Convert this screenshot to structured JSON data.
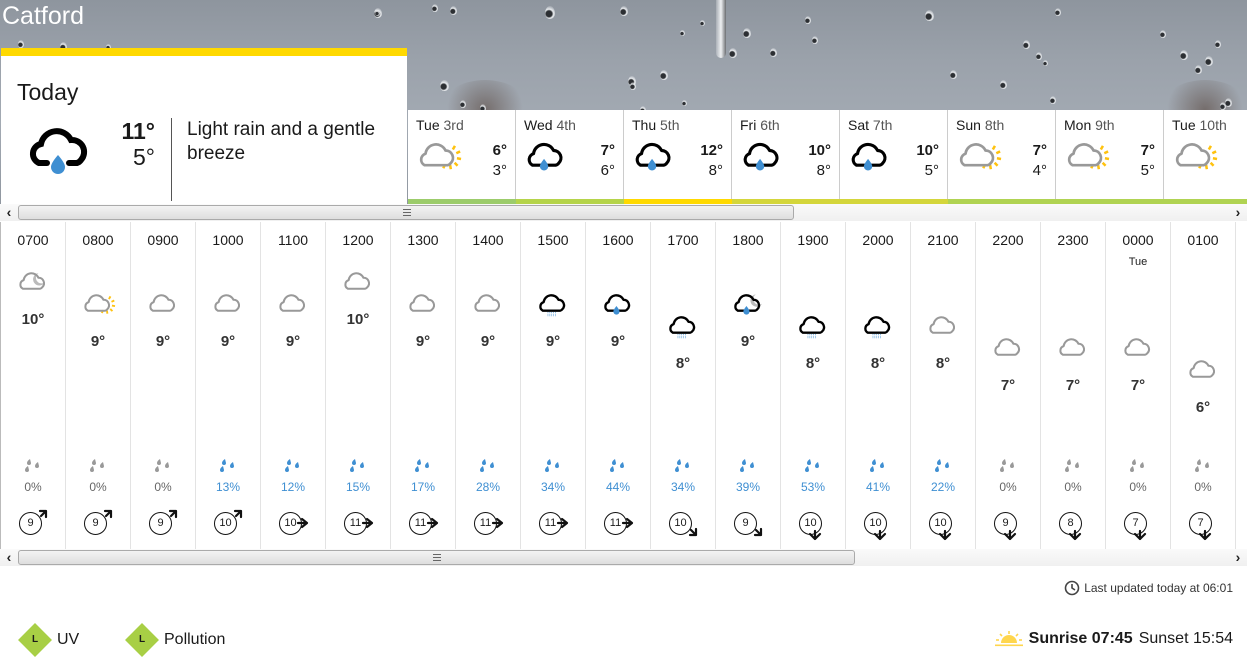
{
  "location": "Catford",
  "today": {
    "title": "Today",
    "icon": "light-rain-icon",
    "max": "11°",
    "min": "5°",
    "description": "Light rain and a gentle breeze",
    "accent_color": "#ffd900"
  },
  "days": [
    {
      "day": "Tue",
      "date": "3rd",
      "icon": "sunny-intervals-icon",
      "max": "6°",
      "min": "3°",
      "bar_color": "#9ccc6b"
    },
    {
      "day": "Wed",
      "date": "4th",
      "icon": "light-rain-icon",
      "max": "7°",
      "min": "6°",
      "bar_color": "#b5d44a"
    },
    {
      "day": "Thu",
      "date": "5th",
      "icon": "light-rain-icon",
      "max": "12°",
      "min": "8°",
      "bar_color": "#ffd900"
    },
    {
      "day": "Fri",
      "date": "6th",
      "icon": "light-rain-icon",
      "max": "10°",
      "min": "8°",
      "bar_color": "#d4d63b"
    },
    {
      "day": "Sat",
      "date": "7th",
      "icon": "light-rain-icon",
      "max": "10°",
      "min": "5°",
      "bar_color": "#d4d63b"
    },
    {
      "day": "Sun",
      "date": "8th",
      "icon": "sunny-intervals-icon",
      "max": "7°",
      "min": "4°",
      "bar_color": "#b0d352"
    },
    {
      "day": "Mon",
      "date": "9th",
      "icon": "sunny-intervals-icon",
      "max": "7°",
      "min": "5°",
      "bar_color": "#b0d352"
    },
    {
      "day": "Tue",
      "date": "10th",
      "icon": "sunny-intervals-icon",
      "max": "",
      "min": "",
      "bar_color": "#b0d352"
    }
  ],
  "hours": [
    {
      "time": "0700",
      "day": "",
      "icon": "partly-cloudy-night-icon",
      "temp": "10°",
      "rain": "0%",
      "wind": "9",
      "wind_dir": "ne"
    },
    {
      "time": "0800",
      "day": "",
      "icon": "sunny-intervals-icon",
      "temp": "9°",
      "rain": "0%",
      "wind": "9",
      "wind_dir": "ne"
    },
    {
      "time": "0900",
      "day": "",
      "icon": "light-cloud-icon",
      "temp": "9°",
      "rain": "0%",
      "wind": "9",
      "wind_dir": "ne"
    },
    {
      "time": "1000",
      "day": "",
      "icon": "light-cloud-icon",
      "temp": "9°",
      "rain": "13%",
      "wind": "10",
      "wind_dir": "ne"
    },
    {
      "time": "1100",
      "day": "",
      "icon": "light-cloud-icon",
      "temp": "9°",
      "rain": "12%",
      "wind": "10",
      "wind_dir": "e"
    },
    {
      "time": "1200",
      "day": "",
      "icon": "light-cloud-icon",
      "temp": "10°",
      "rain": "15%",
      "wind": "11",
      "wind_dir": "e"
    },
    {
      "time": "1300",
      "day": "",
      "icon": "light-cloud-icon",
      "temp": "9°",
      "rain": "17%",
      "wind": "11",
      "wind_dir": "e"
    },
    {
      "time": "1400",
      "day": "",
      "icon": "light-cloud-icon",
      "temp": "9°",
      "rain": "28%",
      "wind": "11",
      "wind_dir": "e"
    },
    {
      "time": "1500",
      "day": "",
      "icon": "drizzle-icon",
      "temp": "9°",
      "rain": "34%",
      "wind": "11",
      "wind_dir": "e"
    },
    {
      "time": "1600",
      "day": "",
      "icon": "light-rain-icon",
      "temp": "9°",
      "rain": "44%",
      "wind": "11",
      "wind_dir": "e"
    },
    {
      "time": "1700",
      "day": "",
      "icon": "drizzle-icon",
      "temp": "8°",
      "rain": "34%",
      "wind": "10",
      "wind_dir": "se"
    },
    {
      "time": "1800",
      "day": "",
      "icon": "light-rain-night-icon",
      "temp": "9°",
      "rain": "39%",
      "wind": "9",
      "wind_dir": "se"
    },
    {
      "time": "1900",
      "day": "",
      "icon": "drizzle-icon",
      "temp": "8°",
      "rain": "53%",
      "wind": "10",
      "wind_dir": "s"
    },
    {
      "time": "2000",
      "day": "",
      "icon": "drizzle-icon",
      "temp": "8°",
      "rain": "41%",
      "wind": "10",
      "wind_dir": "s"
    },
    {
      "time": "2100",
      "day": "",
      "icon": "light-cloud-icon",
      "temp": "8°",
      "rain": "22%",
      "wind": "10",
      "wind_dir": "s"
    },
    {
      "time": "2200",
      "day": "",
      "icon": "light-cloud-icon",
      "temp": "7°",
      "rain": "0%",
      "wind": "9",
      "wind_dir": "s"
    },
    {
      "time": "2300",
      "day": "",
      "icon": "light-cloud-icon",
      "temp": "7°",
      "rain": "0%",
      "wind": "8",
      "wind_dir": "s"
    },
    {
      "time": "0000",
      "day": "Tue",
      "icon": "light-cloud-icon",
      "temp": "7°",
      "rain": "0%",
      "wind": "7",
      "wind_dir": "s"
    },
    {
      "time": "0100",
      "day": "",
      "icon": "light-cloud-icon",
      "temp": "6°",
      "rain": "0%",
      "wind": "7",
      "wind_dir": "s"
    }
  ],
  "colors": {
    "rain_active": "#3f8fd2",
    "rain_none": "#999999",
    "sun": "#ffc20e"
  },
  "footer": {
    "last_updated": "Last updated today at 06:01",
    "uv_level": "L",
    "uv_label": "UV",
    "pollution_level": "L",
    "pollution_label": "Pollution",
    "sunrise_label": "Sunrise 07:45",
    "sunset_label": "Sunset 15:54"
  },
  "scroll": {
    "left_arrow": "‹",
    "right_arrow": "›"
  }
}
